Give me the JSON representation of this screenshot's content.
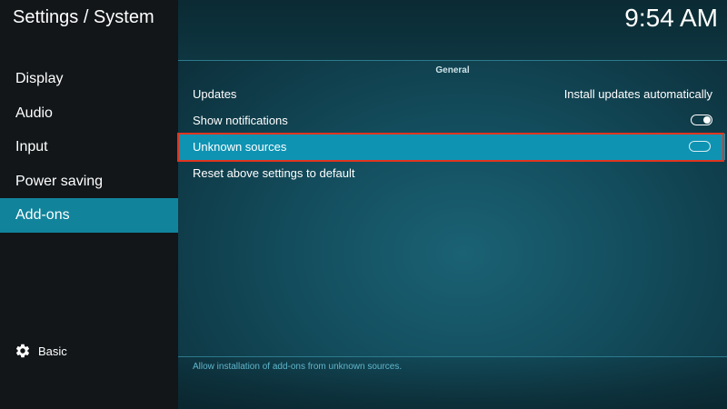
{
  "header": {
    "breadcrumb": "Settings / System",
    "clock": "9:54 AM"
  },
  "sidebar": {
    "items": [
      {
        "label": "Display"
      },
      {
        "label": "Audio"
      },
      {
        "label": "Input"
      },
      {
        "label": "Power saving"
      },
      {
        "label": "Add-ons"
      }
    ],
    "active_item": "Add-ons",
    "level_button": {
      "icon": "gear-icon",
      "label": "Basic"
    }
  },
  "main": {
    "section_title": "General",
    "settings": [
      {
        "label": "Updates",
        "value": "Install updates automatically"
      },
      {
        "label": "Show notifications",
        "toggle": "on"
      },
      {
        "label": "Unknown sources",
        "toggle": "off",
        "focused": true
      },
      {
        "label": "Reset above settings to default"
      }
    ],
    "description": "Allow installation of add-ons from unknown sources."
  },
  "colors": {
    "sidebar_bg": "#121619",
    "active_item": "#11849c",
    "focused_row": "#0e93b3",
    "highlight_border": "#e0351f",
    "description_text": "#5fb6cc"
  }
}
